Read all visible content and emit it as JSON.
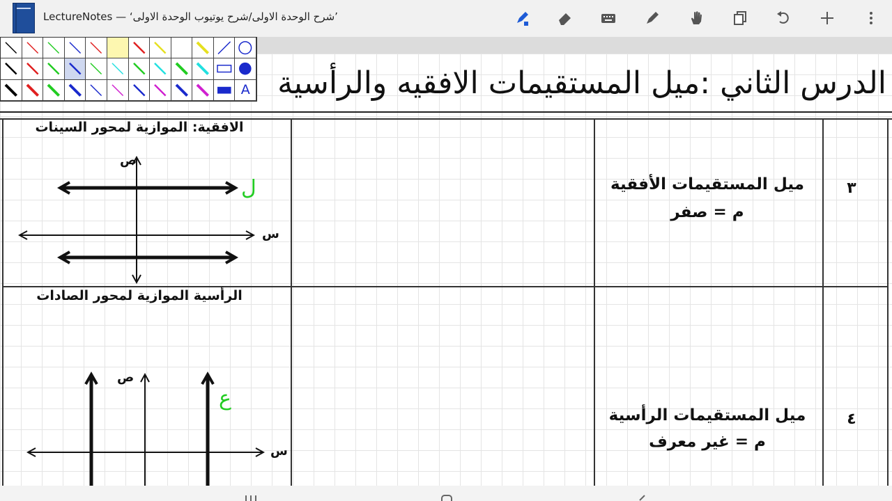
{
  "window": {
    "title": "LectureNotes — ‘شرح الوحدة الاولى/شرح يوتيوب الوحدة الاولى’"
  },
  "toolbar": {
    "buttons": [
      "pen-tool-icon",
      "eraser-icon",
      "keyboard-icon",
      "highlighter-icon",
      "hand-icon",
      "copy-icon",
      "undo-icon",
      "add-icon",
      "more-vert-icon"
    ],
    "accent": "#1e5bd6"
  },
  "palette": {
    "text_tool_label": "A"
  },
  "page": {
    "lesson_title": "الدرس الثاني :ميل المستقيمات الافقيه والرأسية"
  },
  "table": {
    "rows": [
      {
        "number": "٣",
        "name": "ميل المستقيمات الأفقية",
        "slope": "م = صفر",
        "figure_caption": "الافقية: الموازية لمحور السينات",
        "axis_x": "س",
        "axis_y": "ص",
        "handwritten_label": "ل"
      },
      {
        "number": "٤",
        "name": "ميل المستقيمات الرأسية",
        "slope": "م = غير معرف",
        "figure_caption": "الرأسية الموازية لمحور الصادات",
        "axis_x": "س",
        "axis_y": "ص",
        "handwritten_label": "ع"
      }
    ]
  }
}
